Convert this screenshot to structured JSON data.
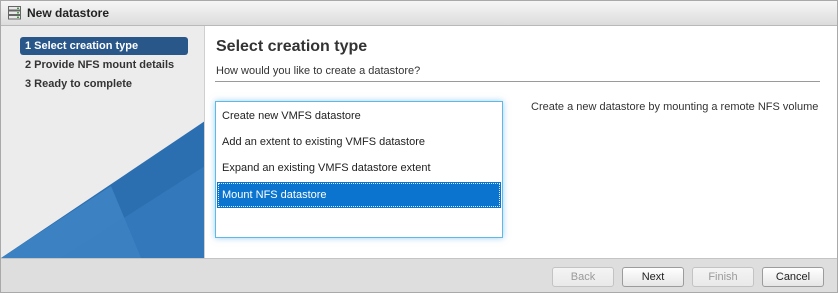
{
  "window": {
    "title": "New datastore",
    "icon": "datastore-icon"
  },
  "sidebar": {
    "steps": [
      {
        "label": "1  Select creation type",
        "active": true
      },
      {
        "label": "2  Provide NFS mount details",
        "active": false
      },
      {
        "label": "3  Ready to complete",
        "active": false
      }
    ]
  },
  "main": {
    "title": "Select creation type",
    "subtitle": "How would you like to create a datastore?",
    "options": [
      {
        "label": "Create new VMFS datastore",
        "selected": false
      },
      {
        "label": "Add an extent to existing VMFS datastore",
        "selected": false
      },
      {
        "label": "Expand an existing VMFS datastore extent",
        "selected": false
      },
      {
        "label": "Mount NFS datastore",
        "selected": true
      }
    ],
    "description": "Create a new datastore by mounting a remote NFS volume"
  },
  "footer": {
    "back_label": "Back",
    "next_label": "Next",
    "finish_label": "Finish",
    "cancel_label": "Cancel"
  },
  "colors": {
    "active_step": "#29578a",
    "selected_option": "#0a74cf",
    "listbox_border": "#5fb9e6",
    "sidebar_art_dark": "#2c6fb0",
    "sidebar_art_light": "#4a90cf"
  }
}
